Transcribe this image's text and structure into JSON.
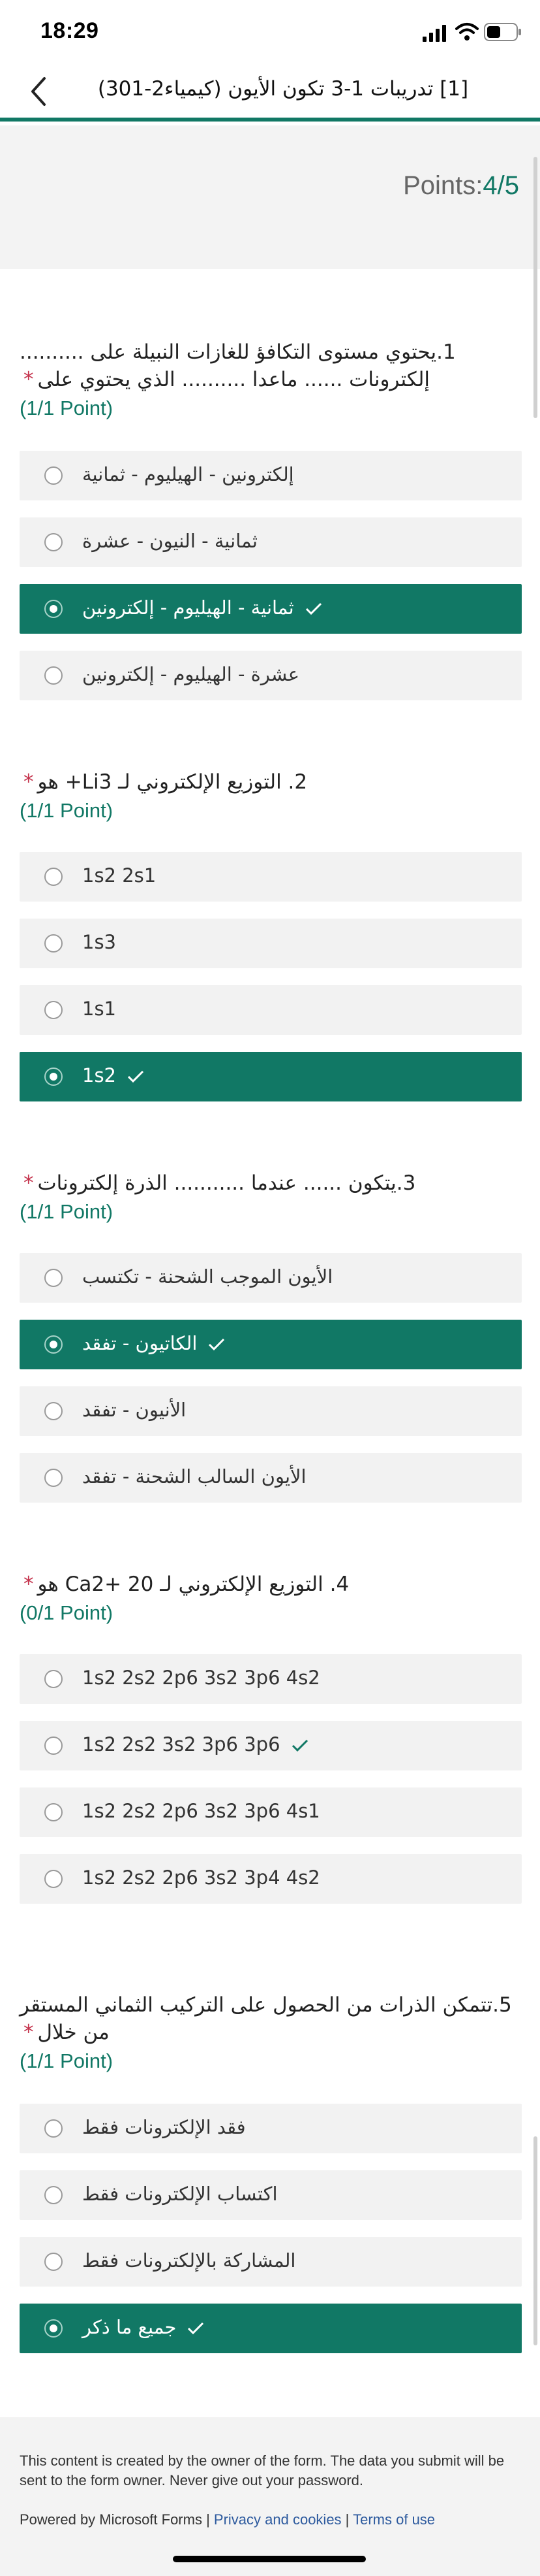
{
  "status": {
    "time": "18:29"
  },
  "nav": {
    "title": "[1] تدريبات 1-3 تكون الأيون (كيمياء2-301)"
  },
  "points": {
    "label": "Points:",
    "score": "4/5"
  },
  "questions": [
    {
      "text": "1.يحتوي مستوى التكافؤ للغازات النبيلة على .......... إلكترونات ...... ماعدا .......... الذي يحتوي على",
      "score": "(1/1 Point)",
      "options": [
        {
          "label": "إلكترونين - الهيليوم - ثمانية",
          "state": "default"
        },
        {
          "label": "ثمانية - النيون - عشرة",
          "state": "default"
        },
        {
          "label": "ثمانية - الهيليوم - إلكترونين",
          "state": "correct-chosen"
        },
        {
          "label": "عشرة - الهيليوم - إلكترونين",
          "state": "default"
        }
      ]
    },
    {
      "text": "2. التوزيع الإلكتروني لـ Li3+ هو",
      "score": "(1/1 Point)",
      "options": [
        {
          "label": "1s2 2s1",
          "state": "default"
        },
        {
          "label": "1s3",
          "state": "default"
        },
        {
          "label": "1s1",
          "state": "default"
        },
        {
          "label": "1s2",
          "state": "correct-chosen"
        }
      ]
    },
    {
      "text": "3.يتكون ...... عندما ........... الذرة إلكترونات",
      "score": "(1/1 Point)",
      "options": [
        {
          "label": "الأيون الموجب الشحنة - تكتسب",
          "state": "default"
        },
        {
          "label": "الكاتيون - تفقد",
          "state": "correct-chosen"
        },
        {
          "label": "الأنيون - تفقد",
          "state": "default"
        },
        {
          "label": "الأيون السالب الشحنة - تفقد",
          "state": "default"
        }
      ]
    },
    {
      "text": "4. التوزيع الإلكتروني لـ Ca2+ 20 هو",
      "score": "(0/1 Point)",
      "options": [
        {
          "label": "1s2 2s2 2p6 3s2 3p6 4s2",
          "state": "default"
        },
        {
          "label": "1s2 2s2 3s2 3p6 3p6",
          "state": "correct-unchosen"
        },
        {
          "label": "1s2 2s2 2p6 3s2 3p6 4s1",
          "state": "default"
        },
        {
          "label": "1s2 2s2 2p6 3s2 3p4 4s2",
          "state": "default"
        }
      ]
    },
    {
      "text": "5.تتمكن الذرات من الحصول على التركيب الثماني المستقر من خلال",
      "score": "(1/1 Point)",
      "options": [
        {
          "label": "فقد الإلكترونات فقط",
          "state": "default"
        },
        {
          "label": "اكتساب الإلكترونات فقط",
          "state": "default"
        },
        {
          "label": "المشاركة بالإلكترونات فقط",
          "state": "default"
        },
        {
          "label": "جميع ما ذكر",
          "state": "correct-chosen"
        }
      ]
    }
  ],
  "footer": {
    "disclaimer": "This content is created by the owner of the form. The data you submit will be sent to the form owner. Never give out your password.",
    "powered": "Powered by Microsoft Forms | ",
    "privacy": "Privacy and cookies",
    "sep": " | ",
    "terms": "Terms of use"
  },
  "colors": {
    "accent": "#117865",
    "required": "#c4314b",
    "link": "#2d5a9e"
  },
  "icons": {
    "back": "chevron-left-icon",
    "check": "checkmark-icon",
    "signal": "signal-icon",
    "wifi": "wifi-icon",
    "battery": "battery-icon"
  }
}
